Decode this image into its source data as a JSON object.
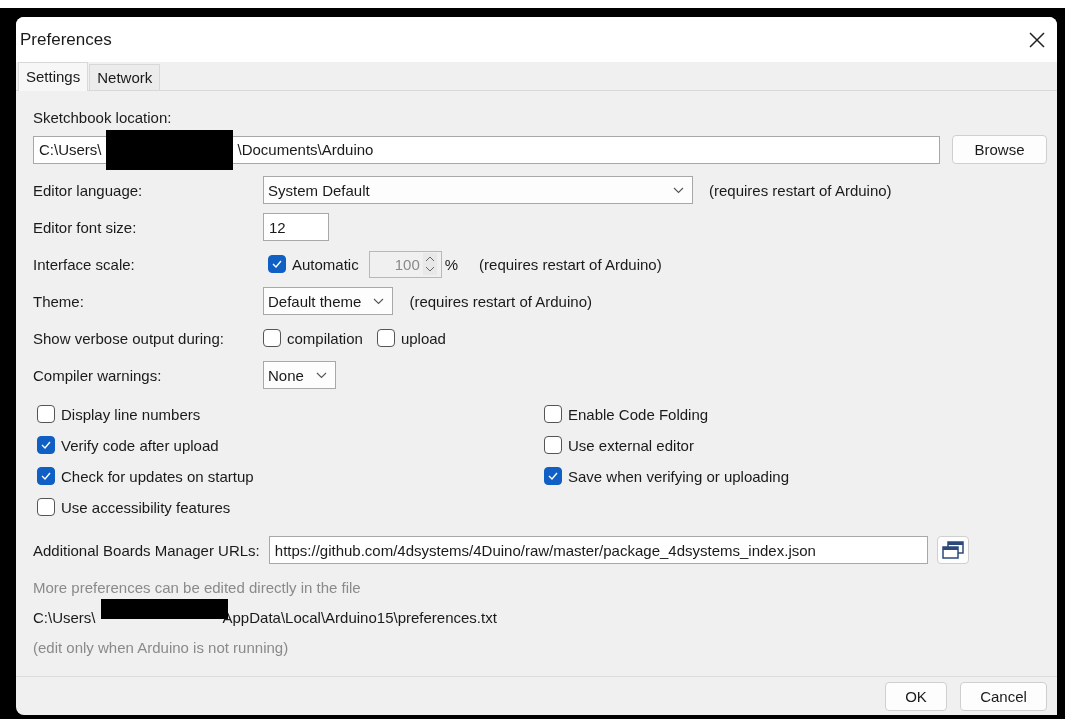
{
  "window": {
    "title": "Preferences"
  },
  "tabs": [
    {
      "label": "Settings",
      "selected": true
    },
    {
      "label": "Network",
      "selected": false
    }
  ],
  "sketchbook": {
    "label": "Sketchbook location:",
    "value_start": "C:\\Users\\",
    "redacted": true,
    "value_end": "\\Documents\\Arduino",
    "button": "Browse"
  },
  "rows": [
    {
      "kind": "combo",
      "label": "Editor language:",
      "value": "System Default",
      "note": "(requires restart of Arduino)"
    },
    {
      "kind": "text",
      "label": "Editor font size:",
      "value": "12"
    },
    {
      "kind": "scale",
      "label": "Interface scale:",
      "auto_label": "Automatic",
      "auto_checked": true,
      "value": "100",
      "disabled": true,
      "unit": "%",
      "note": "(requires restart of Arduino)"
    },
    {
      "kind": "combo",
      "label": "Theme:",
      "value": "Default theme",
      "note": "(requires restart of Arduino)"
    },
    {
      "kind": "checks",
      "label": "Show verbose output during:",
      "options": [
        {
          "label": "compilation",
          "checked": false
        },
        {
          "label": "upload",
          "checked": false
        }
      ]
    },
    {
      "kind": "combo",
      "label": "Compiler warnings:",
      "value": "None"
    }
  ],
  "options": [
    {
      "label": "Display line numbers",
      "checked": false
    },
    {
      "label": "Enable Code Folding",
      "checked": false
    },
    {
      "label": "Verify code after upload",
      "checked": true
    },
    {
      "label": "Use external editor",
      "checked": false
    },
    {
      "label": "Check for updates on startup",
      "checked": true
    },
    {
      "label": "Save when verifying or uploading",
      "checked": true
    },
    {
      "label": "Use accessibility features",
      "checked": false
    }
  ],
  "boards_urls": {
    "label": "Additional Boards Manager URLs:",
    "value": "https://github.com/4dsystems/4Duino/raw/master/package_4dsystems_index.json"
  },
  "footer": {
    "hint": "More preferences can be edited directly in the file",
    "path_start": "C:\\Users\\",
    "redacted": true,
    "path_end": "AppData\\Local\\Arduino15\\preferences.txt",
    "note": "(edit only when Arduino is not running)"
  },
  "buttons": [
    "OK",
    "Cancel"
  ]
}
